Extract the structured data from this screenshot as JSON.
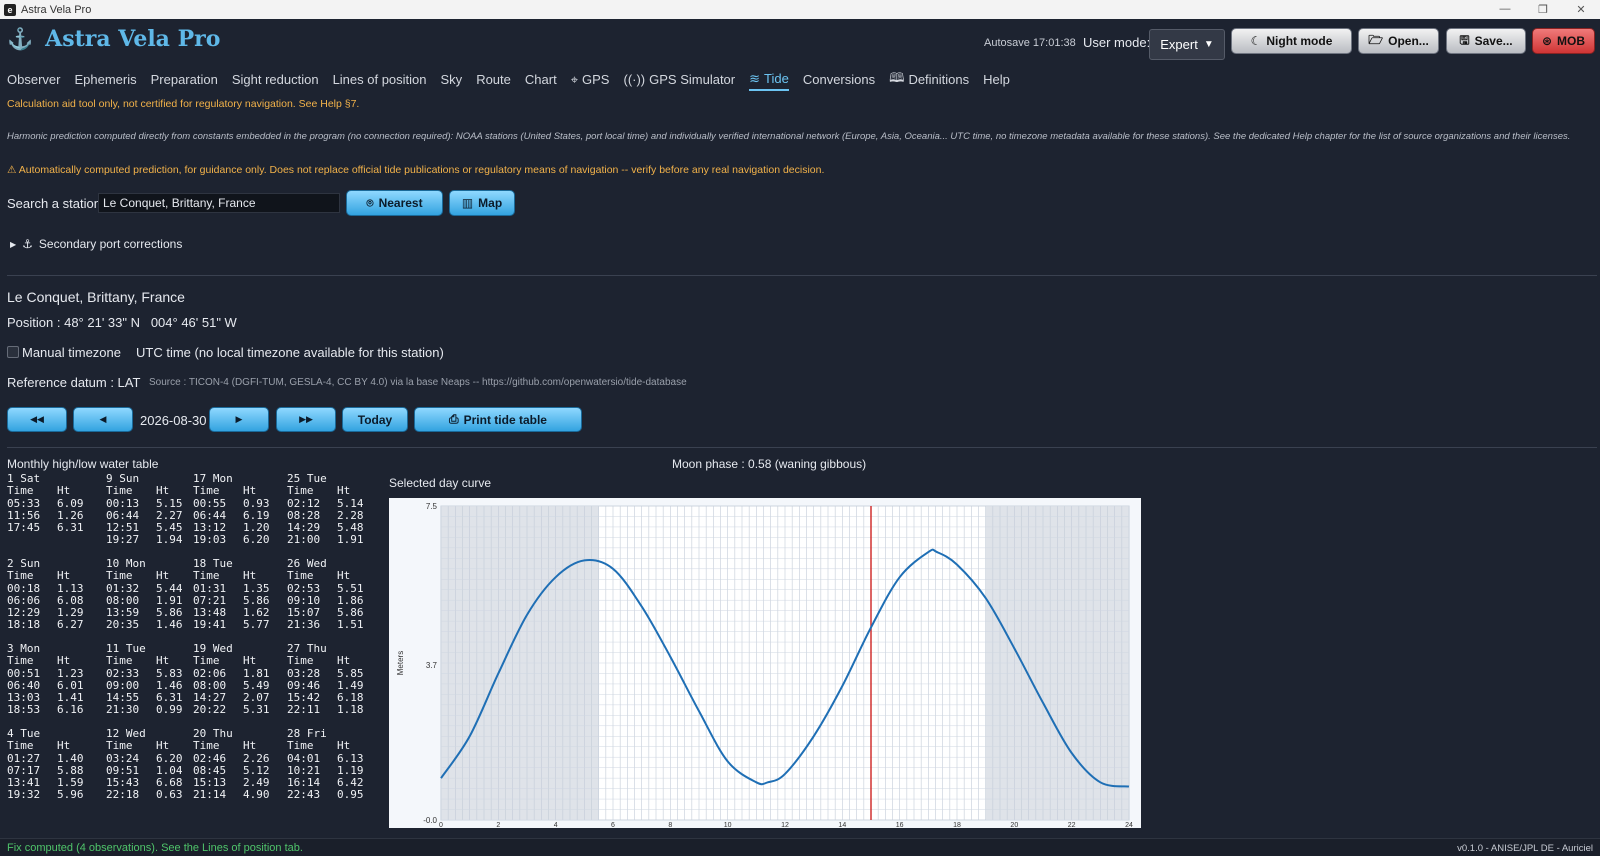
{
  "window": {
    "title": "Astra Vela Pro",
    "app_icon": "e",
    "controls": [
      "—",
      "❐",
      "✕"
    ]
  },
  "header": {
    "app_name": "Astra Vela Pro",
    "autosave": "Autosave 17:01:38",
    "user_mode_label": "User mode:",
    "user_mode_value": "Expert",
    "buttons": {
      "night": "Night mode",
      "open": "Open...",
      "save": "Save...",
      "mob": "MOB"
    }
  },
  "nav": {
    "tabs": [
      "Observer",
      "Ephemeris",
      "Preparation",
      "Sight reduction",
      "Lines of position",
      "Sky",
      "Route",
      "Chart",
      "GPS",
      "GPS Simulator",
      "Tide",
      "Conversions",
      "Definitions",
      "Help"
    ],
    "active": "Tide"
  },
  "disclaimer": "Calculation aid tool only, not certified for regulatory navigation. See Help §7.",
  "tide": {
    "info": "Harmonic prediction computed directly from constants embedded in the program (no connection required): NOAA stations (United States, port local time) and individually verified international network (Europe, Asia, Oceania... UTC time, no timezone metadata available for these stations). See the dedicated Help chapter for the list of source organizations and their licenses.",
    "warning": "⚠ Automatically computed prediction, for guidance only. Does not replace official tide publications or regulatory means of navigation -- verify before any real navigation decision.",
    "search_label": "Search a station:",
    "search_value": "Le Conquet, Brittany, France",
    "nearest_btn": "Nearest",
    "map_btn": "Map",
    "secondary_port": "Secondary port corrections",
    "station_name": "Le Conquet, Brittany, France",
    "position": "Position : 48° 21' 33\" N   004° 46' 51\" W",
    "manual_tz_label": "Manual timezone",
    "utc_note": "UTC time (no local timezone available for this station)",
    "datum": "Reference datum : LAT",
    "source": "Source : TICON-4 (DGFI-TUM, GESLA-4, CC BY 4.0) via la base Neaps -- https://github.com/openwatersio/tide-database",
    "nav_buttons": {
      "fast_back": "◀◀",
      "back": "◀",
      "forward": "▶",
      "fast_forward": "▶▶"
    },
    "date": "2026-08-30",
    "today_btn": "Today",
    "print_btn": "Print tide table",
    "monthly_title": "Monthly high/low water table",
    "moon_phase": "Moon phase : 0.58 (waning gibbous)",
    "curve_title": "Selected day curve"
  },
  "table_headers": {
    "time": "Time",
    "ht": "Ht"
  },
  "tide_table": [
    [
      {
        "day": "1 Sat",
        "rows": [
          [
            "05:33",
            "6.09"
          ],
          [
            "11:56",
            "1.26"
          ],
          [
            "17:45",
            "6.31"
          ]
        ]
      },
      {
        "day": "9 Sun",
        "rows": [
          [
            "00:13",
            "5.15"
          ],
          [
            "06:44",
            "2.27"
          ],
          [
            "12:51",
            "5.45"
          ],
          [
            "19:27",
            "1.94"
          ]
        ]
      },
      {
        "day": "17 Mon",
        "rows": [
          [
            "00:55",
            "0.93"
          ],
          [
            "06:44",
            "6.19"
          ],
          [
            "13:12",
            "1.20"
          ],
          [
            "19:03",
            "6.20"
          ]
        ]
      },
      {
        "day": "25 Tue",
        "rows": [
          [
            "02:12",
            "5.14"
          ],
          [
            "08:28",
            "2.28"
          ],
          [
            "14:29",
            "5.48"
          ],
          [
            "21:00",
            "1.91"
          ]
        ]
      }
    ],
    [
      {
        "day": "2 Sun",
        "rows": [
          [
            "00:18",
            "1.13"
          ],
          [
            "06:06",
            "6.08"
          ],
          [
            "12:29",
            "1.29"
          ],
          [
            "18:18",
            "6.27"
          ]
        ]
      },
      {
        "day": "10 Mon",
        "rows": [
          [
            "01:32",
            "5.44"
          ],
          [
            "08:00",
            "1.91"
          ],
          [
            "13:59",
            "5.86"
          ],
          [
            "20:35",
            "1.46"
          ]
        ]
      },
      {
        "day": "18 Tue",
        "rows": [
          [
            "01:31",
            "1.35"
          ],
          [
            "07:21",
            "5.86"
          ],
          [
            "13:48",
            "1.62"
          ],
          [
            "19:41",
            "5.77"
          ]
        ]
      },
      {
        "day": "26 Wed",
        "rows": [
          [
            "02:53",
            "5.51"
          ],
          [
            "09:10",
            "1.86"
          ],
          [
            "15:07",
            "5.86"
          ],
          [
            "21:36",
            "1.51"
          ]
        ]
      }
    ],
    [
      {
        "day": "3 Mon",
        "rows": [
          [
            "00:51",
            "1.23"
          ],
          [
            "06:40",
            "6.01"
          ],
          [
            "13:03",
            "1.41"
          ],
          [
            "18:53",
            "6.16"
          ]
        ]
      },
      {
        "day": "11 Tue",
        "rows": [
          [
            "02:33",
            "5.83"
          ],
          [
            "09:00",
            "1.46"
          ],
          [
            "14:55",
            "6.31"
          ],
          [
            "21:30",
            "0.99"
          ]
        ]
      },
      {
        "day": "19 Wed",
        "rows": [
          [
            "02:06",
            "1.81"
          ],
          [
            "08:00",
            "5.49"
          ],
          [
            "14:27",
            "2.07"
          ],
          [
            "20:22",
            "5.31"
          ]
        ]
      },
      {
        "day": "27 Thu",
        "rows": [
          [
            "03:28",
            "5.85"
          ],
          [
            "09:46",
            "1.49"
          ],
          [
            "15:42",
            "6.18"
          ],
          [
            "22:11",
            "1.18"
          ]
        ]
      }
    ],
    [
      {
        "day": "4 Tue",
        "rows": [
          [
            "01:27",
            "1.40"
          ],
          [
            "07:17",
            "5.88"
          ],
          [
            "13:41",
            "1.59"
          ],
          [
            "19:32",
            "5.96"
          ]
        ]
      },
      {
        "day": "12 Wed",
        "rows": [
          [
            "03:24",
            "6.20"
          ],
          [
            "09:51",
            "1.04"
          ],
          [
            "15:43",
            "6.68"
          ],
          [
            "22:18",
            "0.63"
          ]
        ]
      },
      {
        "day": "20 Thu",
        "rows": [
          [
            "02:46",
            "2.26"
          ],
          [
            "08:45",
            "5.12"
          ],
          [
            "15:13",
            "2.49"
          ],
          [
            "21:14",
            "4.90"
          ]
        ]
      },
      {
        "day": "28 Fri",
        "rows": [
          [
            "04:01",
            "6.13"
          ],
          [
            "10:21",
            "1.19"
          ],
          [
            "16:14",
            "6.42"
          ],
          [
            "22:43",
            "0.95"
          ]
        ]
      }
    ]
  ],
  "chart_data": {
    "type": "line",
    "title": "Selected day curve",
    "xlabel": "",
    "ylabel": "Meters",
    "xlim": [
      0,
      24
    ],
    "ylim": [
      0,
      7.5
    ],
    "yticks": [
      "7.5",
      "3.7",
      "-0.0"
    ],
    "xticks": [
      0,
      2,
      4,
      6,
      8,
      10,
      12,
      14,
      16,
      18,
      20,
      22,
      24
    ],
    "night_ranges": [
      [
        0,
        5.5
      ],
      [
        19,
        24
      ]
    ],
    "current_time": 15,
    "series": [
      {
        "color": "#1f6fb5",
        "x": [
          0,
          1,
          2,
          3,
          4,
          5,
          6,
          7,
          8,
          9,
          10,
          11,
          11.4,
          12,
          13,
          14,
          15,
          16,
          17,
          17.3,
          18,
          19,
          20,
          21,
          22,
          23,
          24
        ],
        "y": [
          1.0,
          2.0,
          3.5,
          4.9,
          5.8,
          6.2,
          6.0,
          5.1,
          3.9,
          2.6,
          1.4,
          0.9,
          0.9,
          1.1,
          2.0,
          3.2,
          4.6,
          5.8,
          6.4,
          6.4,
          6.1,
          5.3,
          4.1,
          2.8,
          1.6,
          0.9,
          0.8
        ]
      }
    ]
  },
  "status": {
    "left": "Fix computed (4 observations). See the Lines of position tab.",
    "right": "v0.1.0 - ANISE/JPL DE - Auriciel"
  },
  "colors": {
    "accent": "#5fb8e8",
    "warning": "#f2b24a",
    "status_ok": "#4fc46a",
    "mob": "#d83b3b"
  }
}
